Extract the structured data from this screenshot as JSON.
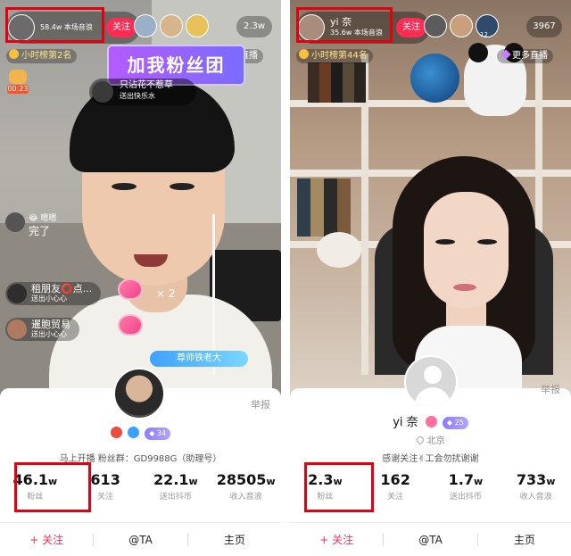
{
  "left": {
    "host": {
      "name": "",
      "sub": "58.4w 本场音浪",
      "follow": "关注"
    },
    "viewer_count": "2.3w",
    "rank": "小时榜第2名",
    "more_live": "更多直播",
    "fan_banner": "加我粉丝团",
    "gift_line1": "只沾花不惹草",
    "gift_line2": "送出快乐水",
    "timer": "00:23",
    "chat": [
      {
        "name": "",
        "act": ""
      },
      {
        "name": "租朋友⭕点...",
        "act": "送出小心心"
      },
      {
        "name": "暹胞贸易",
        "act": "送出小心心"
      }
    ],
    "single_msg_who": "😂 嗯嗯",
    "single_msg_text": "完了",
    "x2": "× 2",
    "badge": "尊师铁老大",
    "report": "举报",
    "fan_line": "马上开播 粉丝群：GD9988G（助理号）",
    "level": "34",
    "stats": [
      {
        "num": "46.1",
        "unit": "w",
        "label": "粉丝"
      },
      {
        "num": "613",
        "unit": "",
        "label": "关注"
      },
      {
        "num": "22.1",
        "unit": "w",
        "label": "送出抖币"
      },
      {
        "num": "28505",
        "unit": "w",
        "label": "收入音浪"
      }
    ],
    "actions": {
      "follow": "+ 关注",
      "at": "@TA",
      "home": "主页"
    }
  },
  "right": {
    "host": {
      "name": "yi 奈",
      "sub": "35.6w 本场音浪",
      "follow": "关注"
    },
    "viewer_count": "3967",
    "viewer_badges": [
      "12"
    ],
    "rank": "小时榜第44名",
    "more_live": "更多直播",
    "report": "举报",
    "name": "yi 奈",
    "level": "25",
    "location": "北京",
    "bio": "感谢关注✌工会勿扰谢谢",
    "stats": [
      {
        "num": "2.3",
        "unit": "w",
        "label": "粉丝"
      },
      {
        "num": "162",
        "unit": "",
        "label": "关注"
      },
      {
        "num": "1.7",
        "unit": "w",
        "label": "送出抖币"
      },
      {
        "num": "733",
        "unit": "w",
        "label": "收入音浪"
      }
    ],
    "actions": {
      "follow": "+ 关注",
      "at": "@TA",
      "home": "主页"
    }
  },
  "colors": {
    "accent": "#fe2c55",
    "highlight": "#e4000f",
    "level": "#8a7cff"
  }
}
